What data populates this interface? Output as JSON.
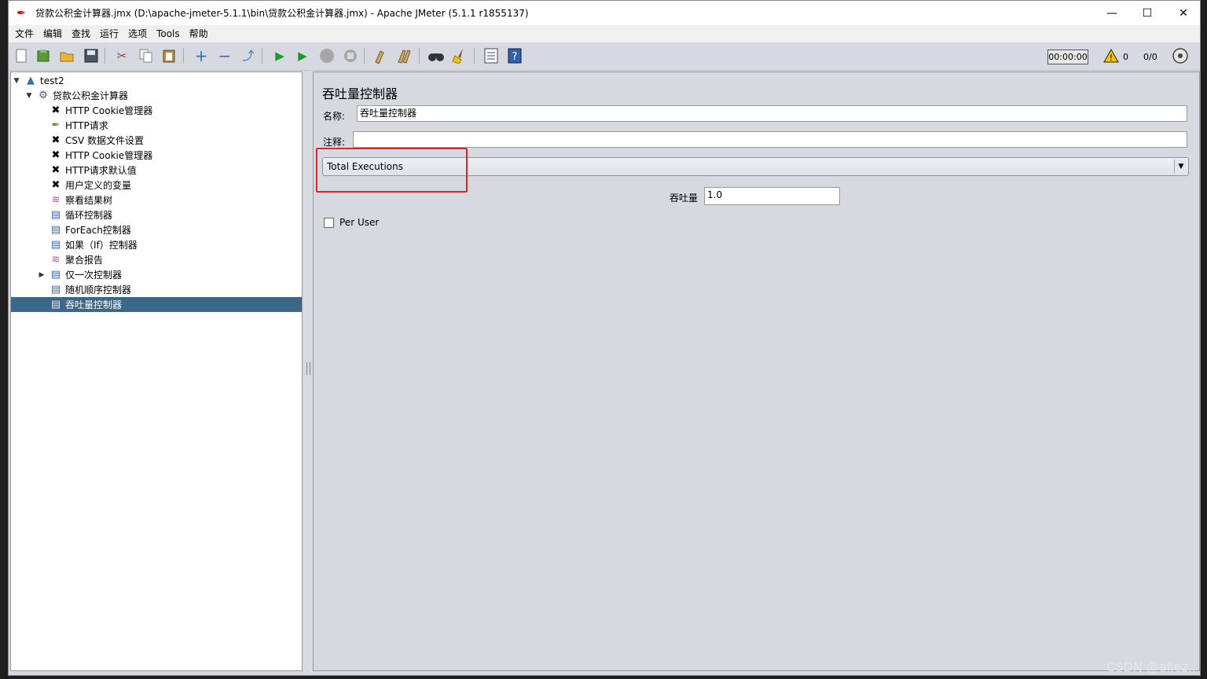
{
  "window": {
    "title": "贷款公积金计算器.jmx (D:\\apache-jmeter-5.1.1\\bin\\贷款公积金计算器.jmx) - Apache JMeter (5.1.1 r1855137)",
    "minimize": "—",
    "maximize": "☐",
    "close": "✕"
  },
  "menu": [
    "文件",
    "编辑",
    "查找",
    "运行",
    "选项",
    "Tools",
    "帮助"
  ],
  "toolbar": {
    "timer": "00:00:00",
    "warning_count": "0",
    "thread_count": "0/0"
  },
  "tree": [
    {
      "label": "test2",
      "icon": "test-plan-icon"
    },
    {
      "label": "贷款公积金计算器",
      "icon": "thread-group-gear-icon"
    },
    {
      "label": "HTTP Cookie管理器",
      "icon": "config-wrench-icon"
    },
    {
      "label": "HTTP请求",
      "icon": "sampler-pipette-icon"
    },
    {
      "label": "CSV 数据文件设置",
      "icon": "config-wrench-icon"
    },
    {
      "label": "HTTP Cookie管理器",
      "icon": "config-wrench-icon"
    },
    {
      "label": "HTTP请求默认值",
      "icon": "config-wrench-icon"
    },
    {
      "label": "用户定义的变量",
      "icon": "config-wrench-icon"
    },
    {
      "label": "察看结果树",
      "icon": "listener-chart-icon"
    },
    {
      "label": "循环控制器",
      "icon": "controller-doc-icon"
    },
    {
      "label": "ForEach控制器",
      "icon": "controller-doc-icon"
    },
    {
      "label": "如果（If）控制器",
      "icon": "controller-doc-icon"
    },
    {
      "label": "聚合报告",
      "icon": "listener-chart-icon"
    },
    {
      "label": "仅一次控制器",
      "icon": "controller-doc-icon"
    },
    {
      "label": "随机顺序控制器",
      "icon": "controller-doc-icon"
    },
    {
      "label": "吞吐量控制器",
      "icon": "controller-doc-icon"
    }
  ],
  "panel": {
    "title": "吞吐量控制器",
    "name_label": "名称:",
    "name_value": "吞吐量控制器",
    "comment_label": "注释:",
    "comment_value": "",
    "mode_selected": "Total Executions",
    "throughput_label": "吞吐量",
    "throughput_value": "1.0",
    "per_user_label": "Per User",
    "per_user_checked": false
  },
  "watermark": "CSDN @aliez.."
}
